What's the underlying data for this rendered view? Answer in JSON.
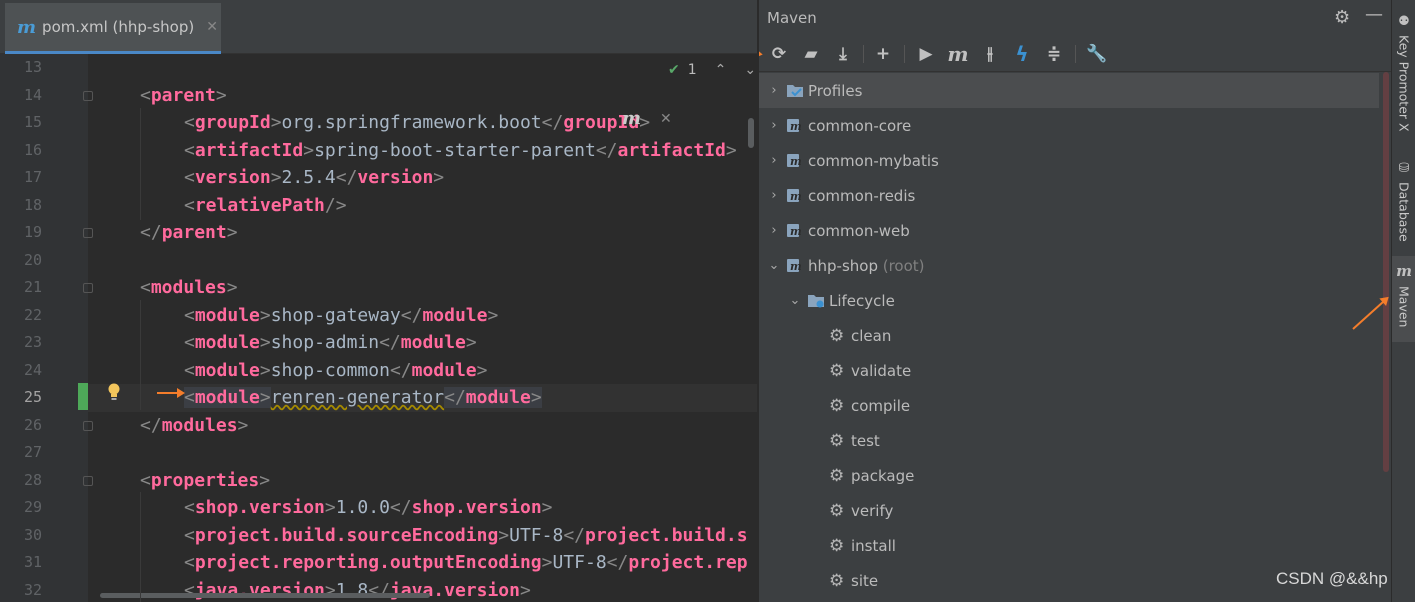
{
  "editor": {
    "tab": {
      "label": "pom.xml (hhp-shop)",
      "icon": "maven-file-icon"
    },
    "status": {
      "inspection_count": "1"
    },
    "lines": [
      {
        "n": "13",
        "parts": []
      },
      {
        "n": "14",
        "parts": [
          [
            "bk",
            "<"
          ],
          [
            "tg",
            "parent"
          ],
          [
            "bk",
            ">"
          ]
        ],
        "indent": 0
      },
      {
        "n": "15",
        "parts": [
          [
            "bk",
            "<"
          ],
          [
            "tg",
            "groupId"
          ],
          [
            "bk",
            ">"
          ],
          [
            "tx",
            "org.springframework.boot"
          ],
          [
            "bk",
            "</"
          ],
          [
            "tg",
            "groupId"
          ],
          [
            "bk",
            ">"
          ]
        ],
        "indent": 1
      },
      {
        "n": "16",
        "parts": [
          [
            "bk",
            "<"
          ],
          [
            "tg",
            "artifactId"
          ],
          [
            "bk",
            ">"
          ],
          [
            "tx",
            "spring-boot-starter-parent"
          ],
          [
            "bk",
            "</"
          ],
          [
            "tg",
            "artifactId"
          ],
          [
            "bk",
            ">"
          ]
        ],
        "indent": 1
      },
      {
        "n": "17",
        "parts": [
          [
            "bk",
            "<"
          ],
          [
            "tg",
            "version"
          ],
          [
            "bk",
            ">"
          ],
          [
            "tx",
            "2.5.4"
          ],
          [
            "bk",
            "</"
          ],
          [
            "tg",
            "version"
          ],
          [
            "bk",
            ">"
          ]
        ],
        "indent": 1
      },
      {
        "n": "18",
        "parts": [
          [
            "bk",
            "<"
          ],
          [
            "tg",
            "relativePath"
          ],
          [
            "bk",
            "/>"
          ]
        ],
        "indent": 1
      },
      {
        "n": "19",
        "parts": [
          [
            "bk",
            "</"
          ],
          [
            "tg",
            "parent"
          ],
          [
            "bk",
            ">"
          ]
        ],
        "indent": 0
      },
      {
        "n": "20",
        "parts": []
      },
      {
        "n": "21",
        "parts": [
          [
            "bk",
            "<"
          ],
          [
            "tg",
            "modules"
          ],
          [
            "bk",
            ">"
          ]
        ],
        "indent": 0
      },
      {
        "n": "22",
        "parts": [
          [
            "bk",
            "<"
          ],
          [
            "tg",
            "module"
          ],
          [
            "bk",
            ">"
          ],
          [
            "tx",
            "shop-gateway"
          ],
          [
            "bk",
            "</"
          ],
          [
            "tg",
            "module"
          ],
          [
            "bk",
            ">"
          ]
        ],
        "indent": 1
      },
      {
        "n": "23",
        "parts": [
          [
            "bk",
            "<"
          ],
          [
            "tg",
            "module"
          ],
          [
            "bk",
            ">"
          ],
          [
            "tx",
            "shop-admin"
          ],
          [
            "bk",
            "</"
          ],
          [
            "tg",
            "module"
          ],
          [
            "bk",
            ">"
          ]
        ],
        "indent": 1
      },
      {
        "n": "24",
        "parts": [
          [
            "bk",
            "<"
          ],
          [
            "tg",
            "module"
          ],
          [
            "bk",
            ">"
          ],
          [
            "tx",
            "shop-common"
          ],
          [
            "bk",
            "</"
          ],
          [
            "tg",
            "module"
          ],
          [
            "bk",
            ">"
          ]
        ],
        "indent": 1
      },
      {
        "n": "25",
        "parts": [
          [
            "hlbk",
            "<"
          ],
          [
            "hltg",
            "module"
          ],
          [
            "hlbk",
            ">"
          ],
          [
            "sq",
            "renren-generator"
          ],
          [
            "hlbk",
            "</"
          ],
          [
            "hltg",
            "module"
          ],
          [
            "hlbk",
            ">"
          ]
        ],
        "indent": 1,
        "current": true
      },
      {
        "n": "26",
        "parts": [
          [
            "bk",
            "</"
          ],
          [
            "tg",
            "modules"
          ],
          [
            "bk",
            ">"
          ]
        ],
        "indent": 0
      },
      {
        "n": "27",
        "parts": []
      },
      {
        "n": "28",
        "parts": [
          [
            "bk",
            "<"
          ],
          [
            "tg",
            "properties"
          ],
          [
            "bk",
            ">"
          ]
        ],
        "indent": 0
      },
      {
        "n": "29",
        "parts": [
          [
            "bk",
            "<"
          ],
          [
            "tg",
            "shop.version"
          ],
          [
            "bk",
            ">"
          ],
          [
            "tx",
            "1.0.0"
          ],
          [
            "bk",
            "</"
          ],
          [
            "tg",
            "shop.version"
          ],
          [
            "bk",
            ">"
          ]
        ],
        "indent": 1
      },
      {
        "n": "30",
        "parts": [
          [
            "bk",
            "<"
          ],
          [
            "tg",
            "project.build.sourceEncoding"
          ],
          [
            "bk",
            ">"
          ],
          [
            "tx",
            "UTF-8"
          ],
          [
            "bk",
            "</"
          ],
          [
            "tg",
            "project.build.s"
          ]
        ],
        "indent": 1
      },
      {
        "n": "31",
        "parts": [
          [
            "bk",
            "<"
          ],
          [
            "tg",
            "project.reporting.outputEncoding"
          ],
          [
            "bk",
            ">"
          ],
          [
            "tx",
            "UTF-8"
          ],
          [
            "bk",
            "</"
          ],
          [
            "tg",
            "project.rep"
          ]
        ],
        "indent": 1
      },
      {
        "n": "32",
        "parts": [
          [
            "bk",
            "<"
          ],
          [
            "tg",
            "java.version"
          ],
          [
            "bk",
            ">"
          ],
          [
            "tx",
            "1.8"
          ],
          [
            "bk",
            "</"
          ],
          [
            "tg",
            "java.version"
          ],
          [
            "bk",
            ">"
          ]
        ],
        "indent": 1
      }
    ]
  },
  "maven": {
    "title": "Maven",
    "toolbar": [
      {
        "name": "reload-icon",
        "glyph": "⟳"
      },
      {
        "name": "add-folder-icon",
        "glyph": "▰"
      },
      {
        "name": "download-icon",
        "glyph": "⤓"
      },
      {
        "name": "add-icon",
        "glyph": "+"
      },
      {
        "name": "run-icon",
        "glyph": "▶"
      },
      {
        "name": "execute-goal-icon",
        "glyph": "m"
      },
      {
        "name": "toggle-offline-icon",
        "glyph": "⫲"
      },
      {
        "name": "skip-tests-icon",
        "glyph": "ϟ"
      },
      {
        "name": "collapse-all-icon",
        "glyph": "≑"
      },
      {
        "name": "settings-wrench-icon",
        "glyph": "🔧"
      }
    ],
    "tree": [
      {
        "label": "Profiles",
        "level": 0,
        "chev": "›",
        "icon": "profiles-icon",
        "selected": true
      },
      {
        "label": "common-core",
        "level": 0,
        "chev": "›",
        "icon": "maven-module-icon"
      },
      {
        "label": "common-mybatis",
        "level": 0,
        "chev": "›",
        "icon": "maven-module-icon"
      },
      {
        "label": "common-redis",
        "level": 0,
        "chev": "›",
        "icon": "maven-module-icon"
      },
      {
        "label": "common-web",
        "level": 0,
        "chev": "›",
        "icon": "maven-module-icon"
      },
      {
        "label": "hhp-shop",
        "suffix": "(root)",
        "level": 0,
        "chev": "⌄",
        "icon": "maven-module-icon"
      },
      {
        "label": "Lifecycle",
        "level": 1,
        "chev": "⌄",
        "icon": "lifecycle-folder-icon"
      },
      {
        "label": "clean",
        "level": 2,
        "icon": "gear-icon"
      },
      {
        "label": "validate",
        "level": 2,
        "icon": "gear-icon"
      },
      {
        "label": "compile",
        "level": 2,
        "icon": "gear-icon"
      },
      {
        "label": "test",
        "level": 2,
        "icon": "gear-icon"
      },
      {
        "label": "package",
        "level": 2,
        "icon": "gear-icon"
      },
      {
        "label": "verify",
        "level": 2,
        "icon": "gear-icon"
      },
      {
        "label": "install",
        "level": 2,
        "icon": "gear-icon"
      },
      {
        "label": "site",
        "level": 2,
        "icon": "gear-icon"
      }
    ]
  },
  "side_strip": [
    {
      "label": "Key Promoter X",
      "icon": "key-promoter-icon"
    },
    {
      "label": "Database",
      "icon": "database-icon"
    },
    {
      "label": "Maven",
      "icon": "maven-icon",
      "active": true
    }
  ],
  "watermark": "CSDN @&&hp"
}
